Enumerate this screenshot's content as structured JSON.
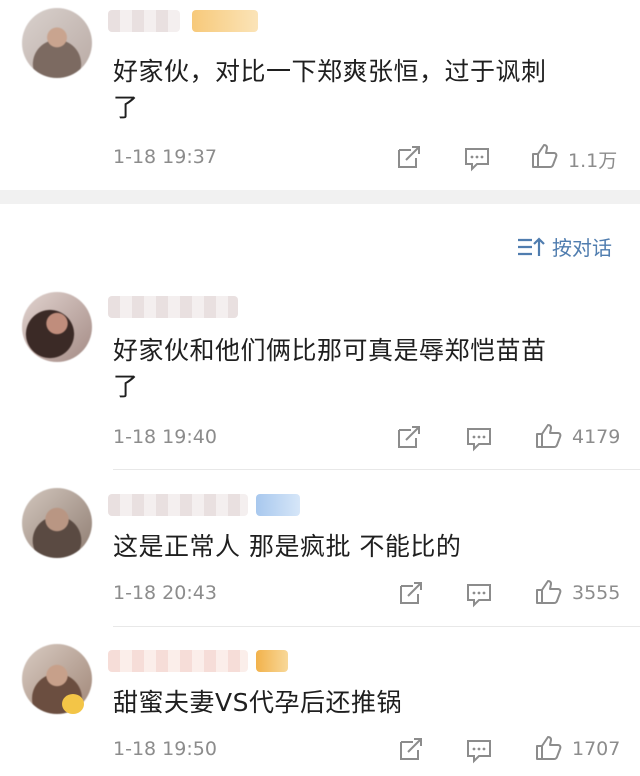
{
  "colors": {
    "link": "#507daf",
    "meta": "#8c8c8c",
    "divider": "#f1f1f1"
  },
  "sort": {
    "icon": "sort-icon",
    "label": "按对话"
  },
  "comments": [
    {
      "text_line1": "好家伙，对比一下郑爽张恒，过于讽刺",
      "text_line2": "了",
      "time": "1-18 19:37",
      "likes": "1.1万"
    },
    {
      "text_line1": "好家伙和他们俩比那可真是辱郑恺苗苗",
      "text_line2": "了",
      "time": "1-18 19:40",
      "likes": "4179"
    },
    {
      "text_line1": "这是正常人 那是疯批 不能比的",
      "text_line2": "",
      "time": "1-18 20:43",
      "likes": "3555"
    },
    {
      "text_line1": "甜蜜夫妻VS代孕后还推锅",
      "text_line2": "",
      "time": "1-18 19:50",
      "likes": "1707"
    }
  ]
}
